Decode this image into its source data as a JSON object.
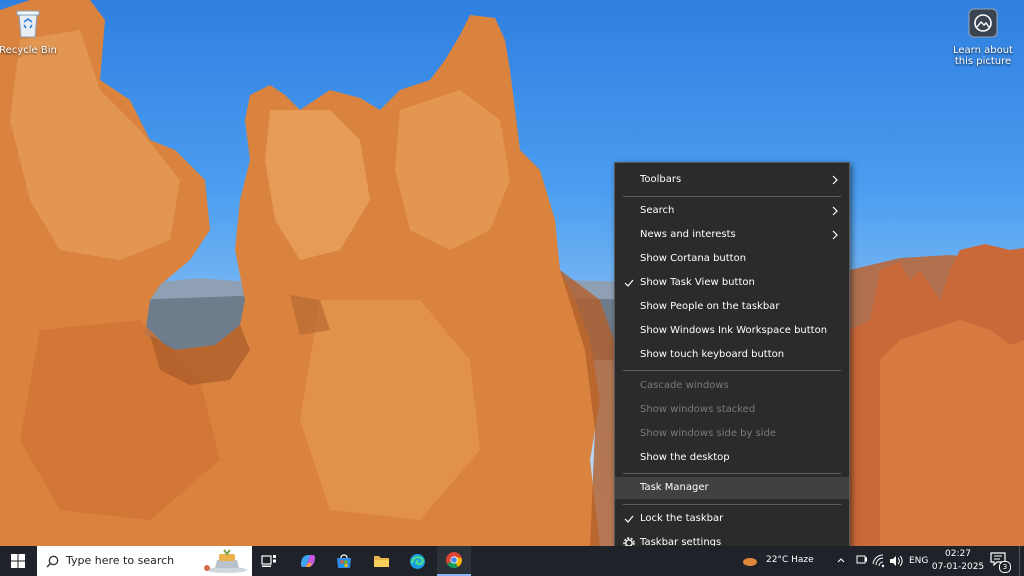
{
  "desktop": {
    "recycle_bin_label": "Recycle Bin",
    "learn_about_label_line1": "Learn about",
    "learn_about_label_line2": "this picture"
  },
  "context_menu": {
    "items": [
      {
        "label": "Toolbars",
        "submenu": true
      },
      {
        "label": "Search",
        "submenu": true
      },
      {
        "label": "News and interests",
        "submenu": true
      },
      {
        "label": "Show Cortana button"
      },
      {
        "label": "Show Task View button",
        "checked": true
      },
      {
        "label": "Show People on the taskbar"
      },
      {
        "label": "Show Windows Ink Workspace button"
      },
      {
        "label": "Show touch keyboard button"
      },
      {
        "label": "Cascade windows",
        "disabled": true
      },
      {
        "label": "Show windows stacked",
        "disabled": true
      },
      {
        "label": "Show windows side by side",
        "disabled": true
      },
      {
        "label": "Show the desktop"
      },
      {
        "label": "Task Manager",
        "highlighted": true
      },
      {
        "label": "Lock the taskbar",
        "checked": true
      },
      {
        "label": "Taskbar settings",
        "icon": "gear-icon"
      }
    ]
  },
  "taskbar": {
    "search_placeholder": "Type here to search",
    "weather_text": "22°C Haze",
    "language": "ENG",
    "time": "02:27",
    "date": "07-01-2025",
    "notification_count": "3",
    "pinned_apps": [
      "task-view-icon",
      "copilot-icon",
      "microsoft-store-icon",
      "file-explorer-icon",
      "edge-icon",
      "chrome-icon"
    ]
  },
  "colors": {
    "menu_bg": "#2b2b2b",
    "menu_highlight": "#414141",
    "taskbar_bg": "#1f2229"
  }
}
